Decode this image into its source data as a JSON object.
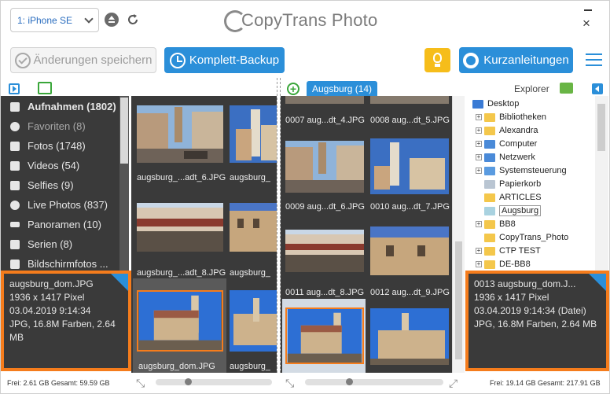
{
  "header": {
    "device": "1: iPhone SE",
    "logo_text": "CopyTrans Photo"
  },
  "toolbar": {
    "save_label": "Änderungen speichern",
    "backup_label": "Komplett-Backup",
    "guides_label": "Kurzanleitungen"
  },
  "album_tag": "Augsburg (14)",
  "explorer_label": "Explorer",
  "nav": {
    "items": [
      {
        "label": "Aufnahmen (1802)",
        "icon": "stack-icon"
      },
      {
        "label": "Favoriten (8)",
        "icon": "heart-icon"
      },
      {
        "label": "Fotos (1748)",
        "icon": "camera-icon"
      },
      {
        "label": "Videos (54)",
        "icon": "video-icon"
      },
      {
        "label": "Selfies (9)",
        "icon": "selfie-icon"
      },
      {
        "label": "Live Photos (837)",
        "icon": "live-photo-icon"
      },
      {
        "label": "Panoramen (10)",
        "icon": "panorama-icon"
      },
      {
        "label": "Serien (8)",
        "icon": "burst-icon"
      },
      {
        "label": "Bildschirmfotos ...",
        "icon": "screenshot-icon"
      }
    ]
  },
  "left_info": {
    "name": "augsburg_dom.JPG",
    "size": "1936 x 1417 Pixel",
    "date": "03.04.2019 9:14:34",
    "meta": "JPG, 16.8M Farben, 2.64 MB"
  },
  "right_info": {
    "name": "0013 augsburg_dom.J...",
    "size": "1936 x 1417 Pixel",
    "date": "03.04.2019 9:14:34  (Datei)",
    "meta": "JPG, 16.8M Farben, 2.64 MB"
  },
  "device_grid": {
    "labels": [
      "augsburg_...adt_6.JPG",
      "augsburg_",
      "augsburg_...adt_8.JPG",
      "augsburg_",
      "augsburg_dom.JPG",
      "augsburg_"
    ]
  },
  "album_grid": {
    "labels": [
      "0007 aug...dt_4.JPG",
      "0008 aug...dt_5.JPG",
      "0009 aug...dt_6.JPG",
      "0010 aug...dt_7.JPG",
      "0011 aug...dt_8.JPG",
      "0012 aug...dt_9.JPG"
    ]
  },
  "explorer": {
    "items": [
      {
        "label": "Desktop"
      },
      {
        "label": "Bibliotheken"
      },
      {
        "label": "Alexandra"
      },
      {
        "label": "Computer"
      },
      {
        "label": "Netzwerk"
      },
      {
        "label": "Systemsteuerung"
      },
      {
        "label": "Papierkorb"
      },
      {
        "label": "ARTICLES"
      },
      {
        "label": "Augsburg"
      },
      {
        "label": "BB8"
      },
      {
        "label": "CopyTrans_Photo"
      },
      {
        "label": "CTP TEST"
      },
      {
        "label": "DE-BB8"
      }
    ]
  },
  "status": {
    "left": "Frei: 2.61 GB Gesamt: 59.59 GB",
    "right": "Frei: 19.14 GB Gesamt: 217.91 GB"
  },
  "colors": {
    "accent": "#2b8fd9",
    "highlight": "#f57c1c",
    "panel": "#3a3a3a",
    "tip": "#f6bd1a"
  }
}
